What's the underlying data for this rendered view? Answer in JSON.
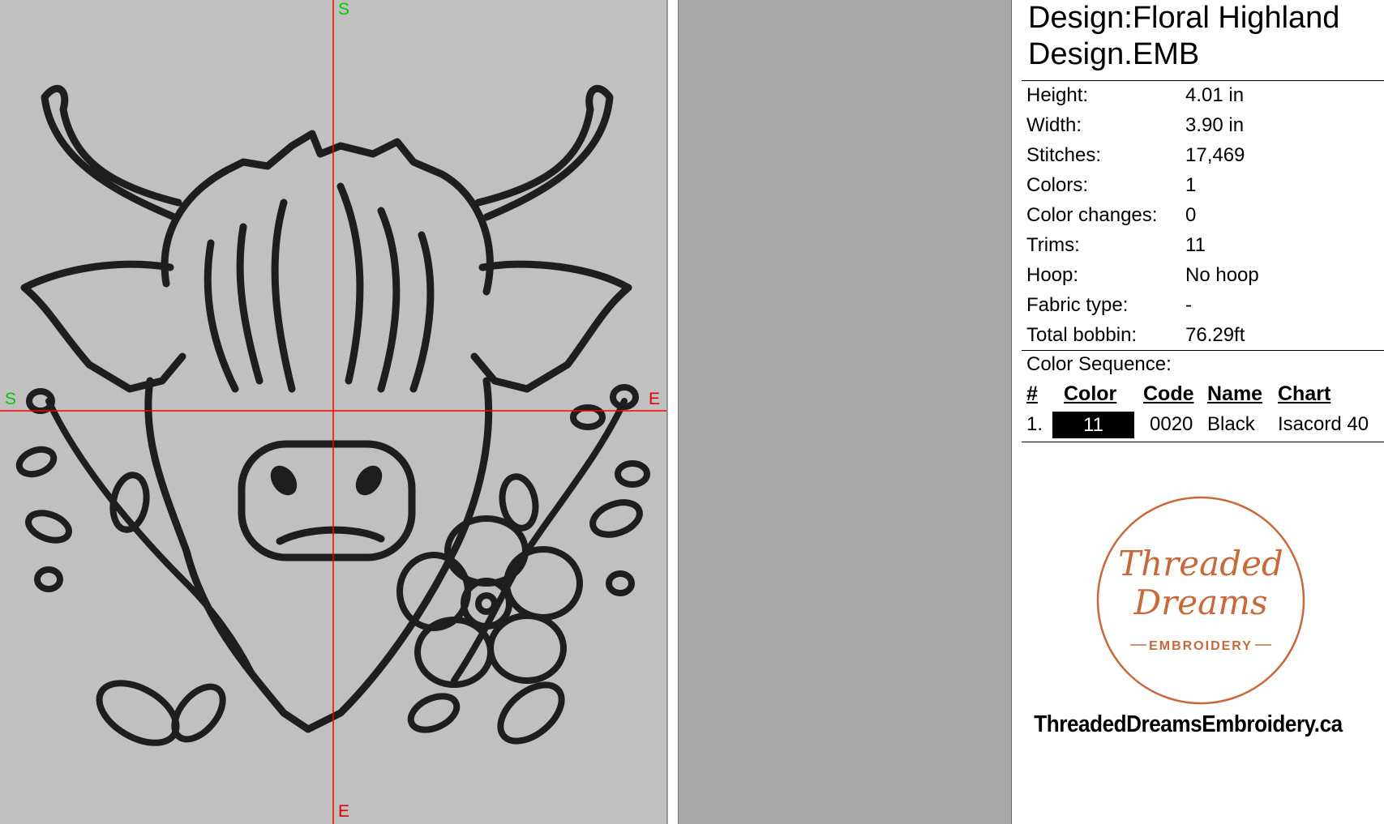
{
  "canvas": {
    "axis_labels": {
      "top": "S",
      "bottom": "E",
      "left": "S",
      "right": "E"
    },
    "colors": {
      "background": "#c0c0c0",
      "crosshair": "#ff0000",
      "start_label": "#00c800",
      "end_label": "#e00000",
      "stitch": "#1e1e1e"
    }
  },
  "panel": {
    "design_title_line1": "Design:Floral Highland",
    "design_title_line2": "Design.EMB",
    "properties": [
      {
        "label": "Height:",
        "value": "4.01 in"
      },
      {
        "label": "Width:",
        "value": "3.90 in"
      },
      {
        "label": "Stitches:",
        "value": "17,469"
      },
      {
        "label": "Colors:",
        "value": "1"
      },
      {
        "label": "Color changes:",
        "value": "0"
      },
      {
        "label": "Trims:",
        "value": "11"
      },
      {
        "label": "Hoop:",
        "value": "No hoop"
      },
      {
        "label": "Fabric type:",
        "value": "-"
      },
      {
        "label": "Total bobbin:",
        "value": "76.29ft"
      }
    ],
    "color_sequence": {
      "title": "Color Sequence:",
      "headers": {
        "num": "#",
        "color": "Color",
        "code": "Code",
        "name": "Name",
        "chart": "Chart"
      },
      "rows": [
        {
          "num": "1.",
          "swatch": "11",
          "swatch_color": "#000000",
          "code": "0020",
          "name": "Black",
          "chart": "Isacord 40"
        }
      ]
    },
    "logo": {
      "line1": "Threaded",
      "line2": "Dreams",
      "line3": "EMBROIDERY",
      "accent": "#c8693a"
    },
    "site_url": "ThreadedDreamsEmbroidery.ca"
  }
}
